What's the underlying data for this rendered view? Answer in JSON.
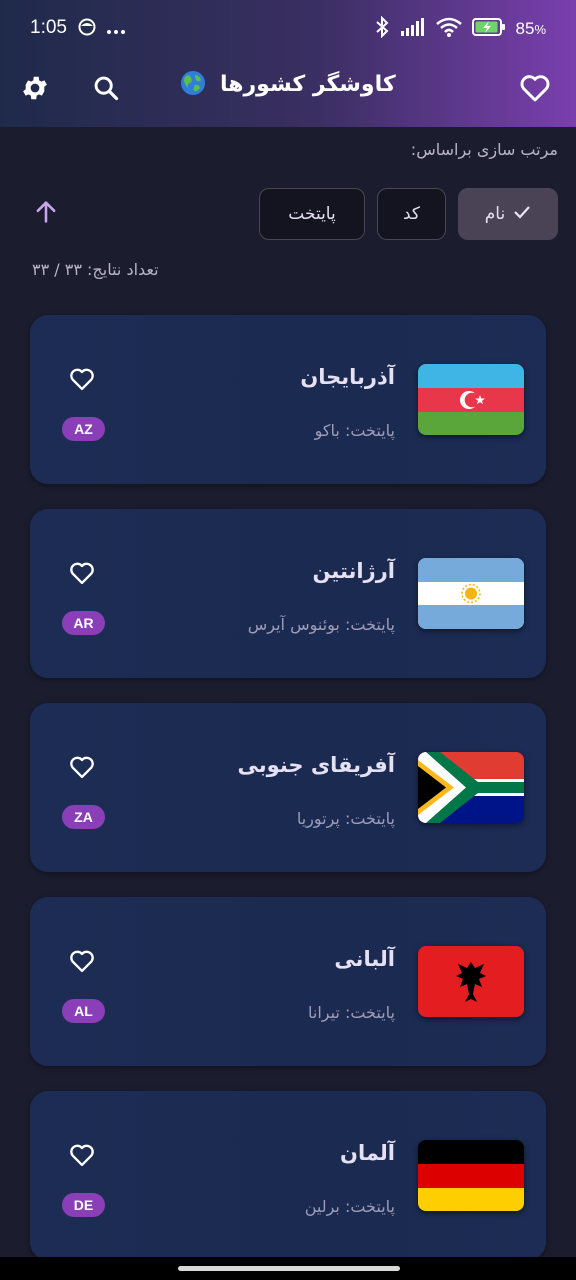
{
  "status_bar": {
    "time": "1:05",
    "battery_percent": "85",
    "battery_suffix": "%",
    "icons": [
      "face-icon",
      "more-dots-icon",
      "bluetooth-icon",
      "signal-icon",
      "wifi-icon",
      "battery-charging-icon"
    ]
  },
  "app_bar": {
    "title": "کاوشگر کشورها",
    "title_icon": "globe-icon",
    "left_icons": [
      "settings-icon",
      "search-icon"
    ],
    "right_icon": "favorites-heart-icon",
    "accent_colors": [
      "#1f2a4a",
      "#7a3fae"
    ]
  },
  "sort": {
    "label": "مرتب سازی براساس:",
    "options": [
      {
        "label": "نام",
        "selected": true
      },
      {
        "label": "کد",
        "selected": false
      },
      {
        "label": "پایتخت",
        "selected": false
      }
    ],
    "direction_icon": "arrow-up-icon"
  },
  "results": {
    "text": "تعداد نتایج: ۳۳ / ۳۳"
  },
  "countries": [
    {
      "name": "آذربایجان",
      "capital": "پایتخت: باکو",
      "code": "AZ",
      "flag": "azerbaijan-flag-icon"
    },
    {
      "name": "آرژانتین",
      "capital": "پایتخت: بوئنوس آیرس",
      "code": "AR",
      "flag": "argentina-flag-icon"
    },
    {
      "name": "آفریقای جنوبی",
      "capital": "پایتخت: پرتوریا",
      "code": "ZA",
      "flag": "south-africa-flag-icon"
    },
    {
      "name": "آلبانی",
      "capital": "پایتخت: تیرانا",
      "code": "AL",
      "flag": "albania-flag-icon"
    },
    {
      "name": "آلمان",
      "capital": "پایتخت: برلین",
      "code": "DE",
      "flag": "germany-flag-icon"
    }
  ],
  "badge_color": "#8a3fb8"
}
